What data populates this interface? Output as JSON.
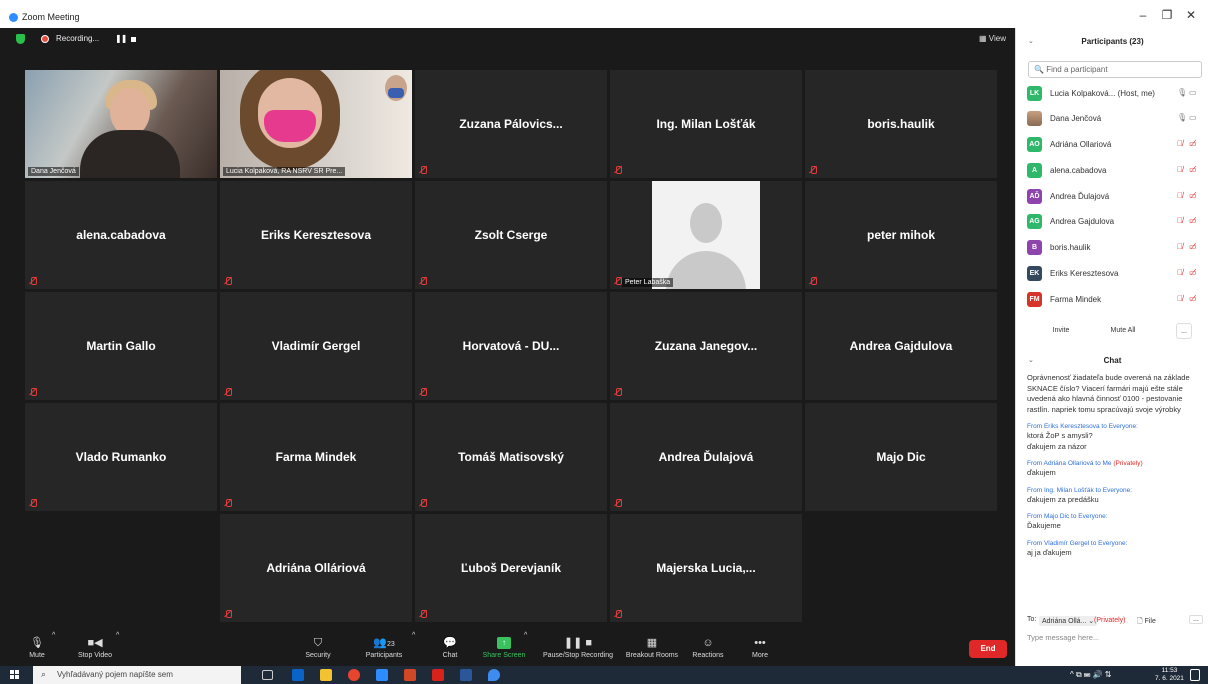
{
  "window": {
    "title": "Zoom Meeting",
    "minimize": "–",
    "restore": "❐",
    "close": "✕"
  },
  "topbar": {
    "recording_label": "Recording...",
    "pause_glyph": "❚❚",
    "view_label": "View"
  },
  "grid": {
    "row1": [
      "Dana Jenčová",
      "Lucia Kolpaková, RA NSRV SR Pre...",
      "Zuzana Pálovics...",
      "Ing. Milan Lošťák",
      "boris.haulik"
    ],
    "row2": [
      "alena.cabadova",
      "Eriks Keresztesova",
      "Zsolt Cserge",
      "Peter Labaška",
      "peter mihok"
    ],
    "row3": [
      "Martin Gallo",
      "Vladimír Gergel",
      "Horvatová - DU...",
      "Zuzana Janegov...",
      "Andrea Gajdulova"
    ],
    "row4": [
      "Vlado Rumanko",
      "Farma Mindek",
      "Tomáš Matisovský",
      "Andrea Ďulajová",
      "Majo Dic"
    ],
    "row5": [
      "Adriána Olláriová",
      "Ľuboš Derevjaník",
      "Majerska Lucia,..."
    ]
  },
  "toolbar": {
    "mute": "Mute",
    "stop_video": "Stop Video",
    "security": "Security",
    "participants": "Participants",
    "participants_count": "23",
    "chat": "Chat",
    "share_screen": "Share Screen",
    "pause_recording": "Pause/Stop Recording",
    "breakout": "Breakout Rooms",
    "reactions": "Reactions",
    "more": "More",
    "end": "End"
  },
  "participants_panel": {
    "title": "Participants (23)",
    "search_placeholder": "Find a participant",
    "rows": [
      {
        "initials": "LK",
        "name": "Lucia Kolpaková... (Host, me)",
        "color": "#2fb86a"
      },
      {
        "initials": "",
        "name": "Dana Jenčová",
        "color": "#b08060"
      },
      {
        "initials": "AO",
        "name": "Adriána Ollariová",
        "color": "#2fb86a"
      },
      {
        "initials": "A",
        "name": "alena.cabadova",
        "color": "#2fb86a"
      },
      {
        "initials": "AĎ",
        "name": "Andrea Ďulajová",
        "color": "#8e44ad"
      },
      {
        "initials": "AG",
        "name": "Andrea Gajdulova",
        "color": "#2fb86a"
      },
      {
        "initials": "B",
        "name": "boris.haulik",
        "color": "#8e44ad"
      },
      {
        "initials": "EK",
        "name": "Eriks Keresztesova",
        "color": "#34495e"
      },
      {
        "initials": "FM",
        "name": "Farma Mindek",
        "color": "#d6342a"
      }
    ],
    "invite": "Invite",
    "mute_all": "Mute All",
    "more": "..."
  },
  "chat": {
    "title": "Chat",
    "first_message": "Oprávnenosť žiadateľa bude overená na základe SKNACE číslo? Viacerí farmári majú ešte stále uvedená ako hlavná činnosť 0100 - pestovanie rastlín. napriek tomu spracúvajú svoje výrobky",
    "messages": [
      {
        "from": "From Eriks Keresztesova to Everyone:",
        "text1": "ktorá ŽoP s amysli?",
        "text2": "ďakujem za názor"
      },
      {
        "from": "From Adriána Ollariová to Me",
        "private": "(Privately)",
        "text1": "ďakujem",
        "text2": ""
      },
      {
        "from": "From Ing. Milan Lošťák to Everyone:",
        "text1": "ďakujem za predášku",
        "text2": ""
      },
      {
        "from": "From Majo Dic to Everyone:",
        "text1": "Ďakujeme",
        "text2": ""
      },
      {
        "from": "From Vladimír Gergel to Everyone:",
        "text1": "aj ja ďakujem",
        "text2": ""
      }
    ],
    "to_label": "To:",
    "to_value": "Adriána Ollá... ⌄",
    "private_label": "(Privately)",
    "file_label": "File",
    "more": "...",
    "input_placeholder": "Type message here..."
  },
  "taskbar": {
    "search_text": "Vyhľadávaný pojem napíšte sem",
    "time": "11:53",
    "date": "7. 6. 2021"
  }
}
